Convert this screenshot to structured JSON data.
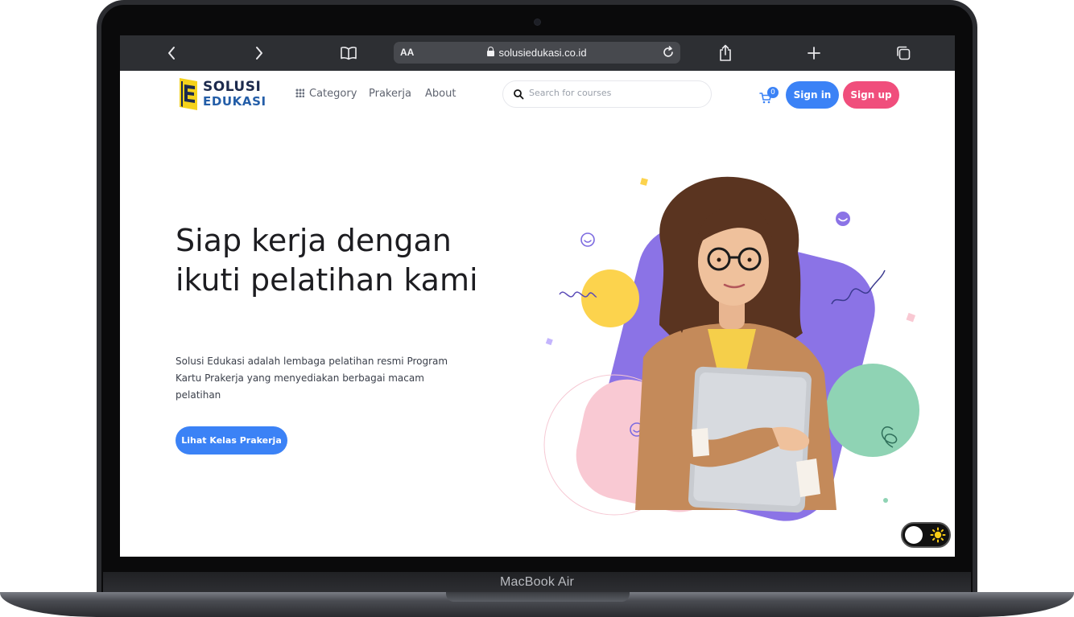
{
  "device": {
    "label": "MacBook Air"
  },
  "browser": {
    "reader_label": "AA",
    "url": "solusiedukasi.co.id"
  },
  "brand": {
    "line1": "SOLUSI",
    "line2": "EDUKASI"
  },
  "nav": {
    "category": "Category",
    "prakerja": "Prakerja",
    "about": "About"
  },
  "search": {
    "placeholder": "Search for courses"
  },
  "cart": {
    "count": "0"
  },
  "auth": {
    "signin": "Sign in",
    "signup": "Sign up"
  },
  "hero": {
    "title": "Siap kerja dengan ikuti pelatihan kami",
    "description": "Solusi Edukasi adalah lembaga pelatihan resmi Program Kartu Prakerja yang menyediakan berbagai macam pelatihan",
    "cta": "Lihat Kelas Prakerja"
  },
  "colors": {
    "primary": "#3b82f6",
    "secondary": "#f04e7c",
    "purple": "#8b73e6",
    "yellow": "#fcd34d",
    "pink": "#f9c9d3",
    "green": "#8fd3b4"
  },
  "theme_toggle": {
    "state": "light"
  }
}
